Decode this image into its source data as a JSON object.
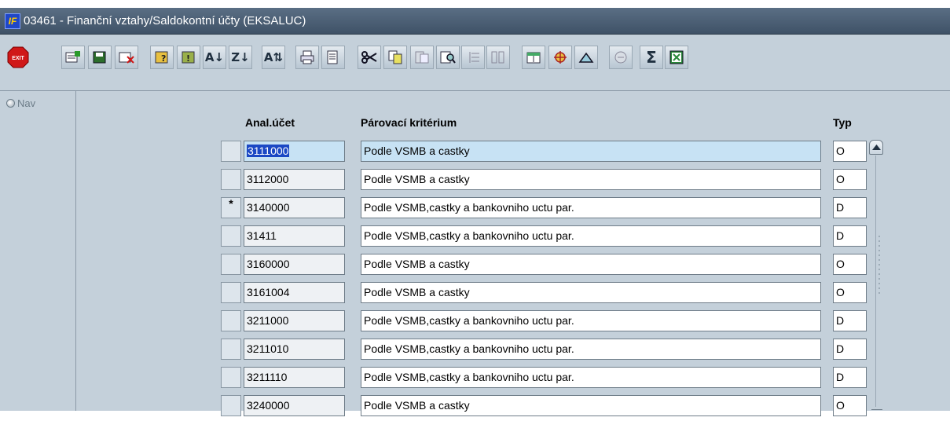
{
  "window": {
    "app_icon": "IF",
    "title": "03461 - Finanční vztahy/Saldokontní účty (EKSALUC)"
  },
  "toolbar": {
    "buttons": [
      {
        "icon": "exit-icon",
        "label": "EXIT"
      },
      {
        "icon": "insert-record-icon"
      },
      {
        "icon": "save-record-icon"
      },
      {
        "icon": "delete-record-icon"
      },
      {
        "icon": "query-enter-icon"
      },
      {
        "icon": "query-execute-icon"
      },
      {
        "icon": "sort-ascending-icon"
      },
      {
        "icon": "sort-descending-icon"
      },
      {
        "icon": "sort-multi-icon"
      },
      {
        "icon": "print-icon"
      },
      {
        "icon": "print-preview-icon"
      },
      {
        "icon": "cut-icon"
      },
      {
        "icon": "copy-icon"
      },
      {
        "icon": "paste-icon"
      },
      {
        "icon": "find-icon"
      },
      {
        "icon": "list-icon"
      },
      {
        "icon": "columns-icon"
      },
      {
        "icon": "export-icon"
      },
      {
        "icon": "settings-icon"
      },
      {
        "icon": "chart-icon"
      },
      {
        "icon": "calculator-icon"
      },
      {
        "icon": "sum-icon",
        "label": "Σ"
      },
      {
        "icon": "excel-icon"
      }
    ]
  },
  "nav": {
    "label": "Nav"
  },
  "table": {
    "columns": {
      "code": "Anal.účet",
      "criterion": "Párovací kritérium",
      "type": "Typ"
    },
    "rows": [
      {
        "mark": "",
        "code": "3111000",
        "criterion": "Podle VSMB a castky",
        "type": "O",
        "selected": true
      },
      {
        "mark": "",
        "code": "3112000",
        "criterion": "Podle VSMB a castky",
        "type": "O"
      },
      {
        "mark": "*",
        "code": "3140000",
        "criterion": "Podle VSMB,castky a bankovniho uctu par.",
        "type": "D"
      },
      {
        "mark": "",
        "code": "31411",
        "criterion": "Podle VSMB,castky a bankovniho uctu par.",
        "type": "D"
      },
      {
        "mark": "",
        "code": "3160000",
        "criterion": "Podle VSMB a castky",
        "type": "O"
      },
      {
        "mark": "",
        "code": "3161004",
        "criterion": "Podle VSMB a castky",
        "type": "O"
      },
      {
        "mark": "",
        "code": "3211000",
        "criterion": "Podle VSMB,castky a bankovniho uctu par.",
        "type": "D"
      },
      {
        "mark": "",
        "code": "3211010",
        "criterion": "Podle VSMB,castky a bankovniho uctu par.",
        "type": "D"
      },
      {
        "mark": "",
        "code": "3211110",
        "criterion": "Podle VSMB,castky a bankovniho uctu par.",
        "type": "D"
      },
      {
        "mark": "",
        "code": "3240000",
        "criterion": "Podle VSMB a castky",
        "type": "O"
      }
    ]
  },
  "colors": {
    "selection": "#1b48c4",
    "selected_row": "#c7e2f4",
    "panel": "#c4d0da",
    "titlebar": "#4a5d72"
  }
}
